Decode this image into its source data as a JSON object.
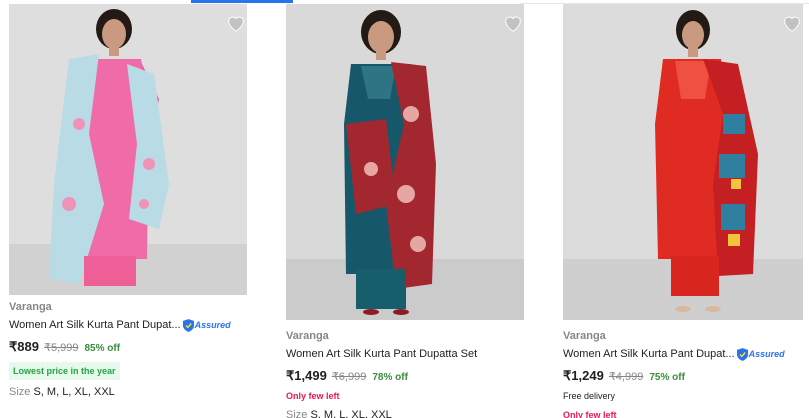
{
  "products": [
    {
      "brand": "Varanga",
      "title": "Women Art Silk Kurta Pant Dupat...",
      "assured": "Assured",
      "price": "₹889",
      "mrp": "₹5,999",
      "discount": "85% off",
      "badge": "Lowest price in the year",
      "size_label": "Size",
      "sizes": "S, M, L, XL, XXL",
      "colors": {
        "bg": "#dcdcdc",
        "kurta": "#f06ca8",
        "dupatta": "#b9dbe6",
        "pant": "#ef5f97"
      }
    },
    {
      "brand": "Varanga",
      "title": "Women Art Silk Kurta Pant Dupatta Set",
      "price": "₹1,499",
      "mrp": "₹6,999",
      "discount": "78% off",
      "stock": "Only few left",
      "size_label": "Size",
      "sizes": "S, M, L, XL, XXL",
      "colors": {
        "bg": "#d6d6d6",
        "kurta": "#16586a",
        "dupatta": "#a3272f",
        "pant": "#175e6d"
      }
    },
    {
      "brand": "Varanga",
      "title": "Women Art Silk Kurta Pant Dupat...",
      "assured": "Assured",
      "price": "₹1,249",
      "mrp": "₹4,999",
      "discount": "75% off",
      "delivery": "Free delivery",
      "stock": "Only few left",
      "colors": {
        "bg": "#d9d9d9",
        "kurta": "#e02b22",
        "dupatta": "#c41f22",
        "pant": "#d8261f"
      }
    }
  ],
  "icons": {
    "wishlist": "heart-icon",
    "assured": "shield-check-icon"
  }
}
